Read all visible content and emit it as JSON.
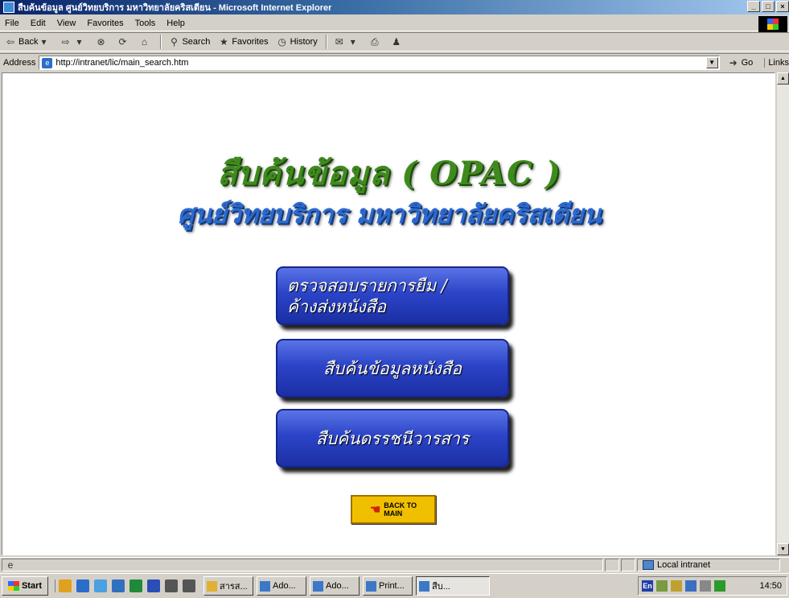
{
  "window": {
    "title": "สืบค้นข้อมูล ศูนย์วิทยบริการ มหาวิทยาลัยคริสเตียน - Microsoft Internet Explorer"
  },
  "menu": {
    "file": "File",
    "edit": "Edit",
    "view": "View",
    "favorites": "Favorites",
    "tools": "Tools",
    "help": "Help"
  },
  "toolbar": {
    "back": "Back",
    "search": "Search",
    "favorites": "Favorites",
    "history": "History"
  },
  "address": {
    "label": "Address",
    "url": "http://intranet/lic/main_search.htm",
    "go": "Go",
    "links": "Links"
  },
  "page": {
    "heading": "สืบค้นข้อมูล ( OPAC )",
    "subheading": "ศูนย์วิทยบริการ มหาวิทยาลัยคริสเตียน",
    "buttons": {
      "check_loans_line1": "ตรวจสอบรายการยืม /",
      "check_loans_line2": "ค้างส่งหนังสือ",
      "search_books": "สืบค้นข้อมูลหนังสือ",
      "search_journals": "สืบค้นดรรชนีวารสาร"
    },
    "back_to_main": {
      "line1": "BACK TO",
      "line2": "MAIN"
    }
  },
  "status": {
    "zone": "Local intranet"
  },
  "taskbar": {
    "start": "Start",
    "tasks": [
      "สารส...",
      "Ado...",
      "Ado...",
      "Print...",
      "สืบ..."
    ],
    "clock": "14:50",
    "lang": "En"
  },
  "colors": {
    "heading_green": "#3f8a1e",
    "subheading_blue": "#2c6ad0",
    "button_blue": "#2b44c8",
    "titlebar": "#0a246a"
  }
}
